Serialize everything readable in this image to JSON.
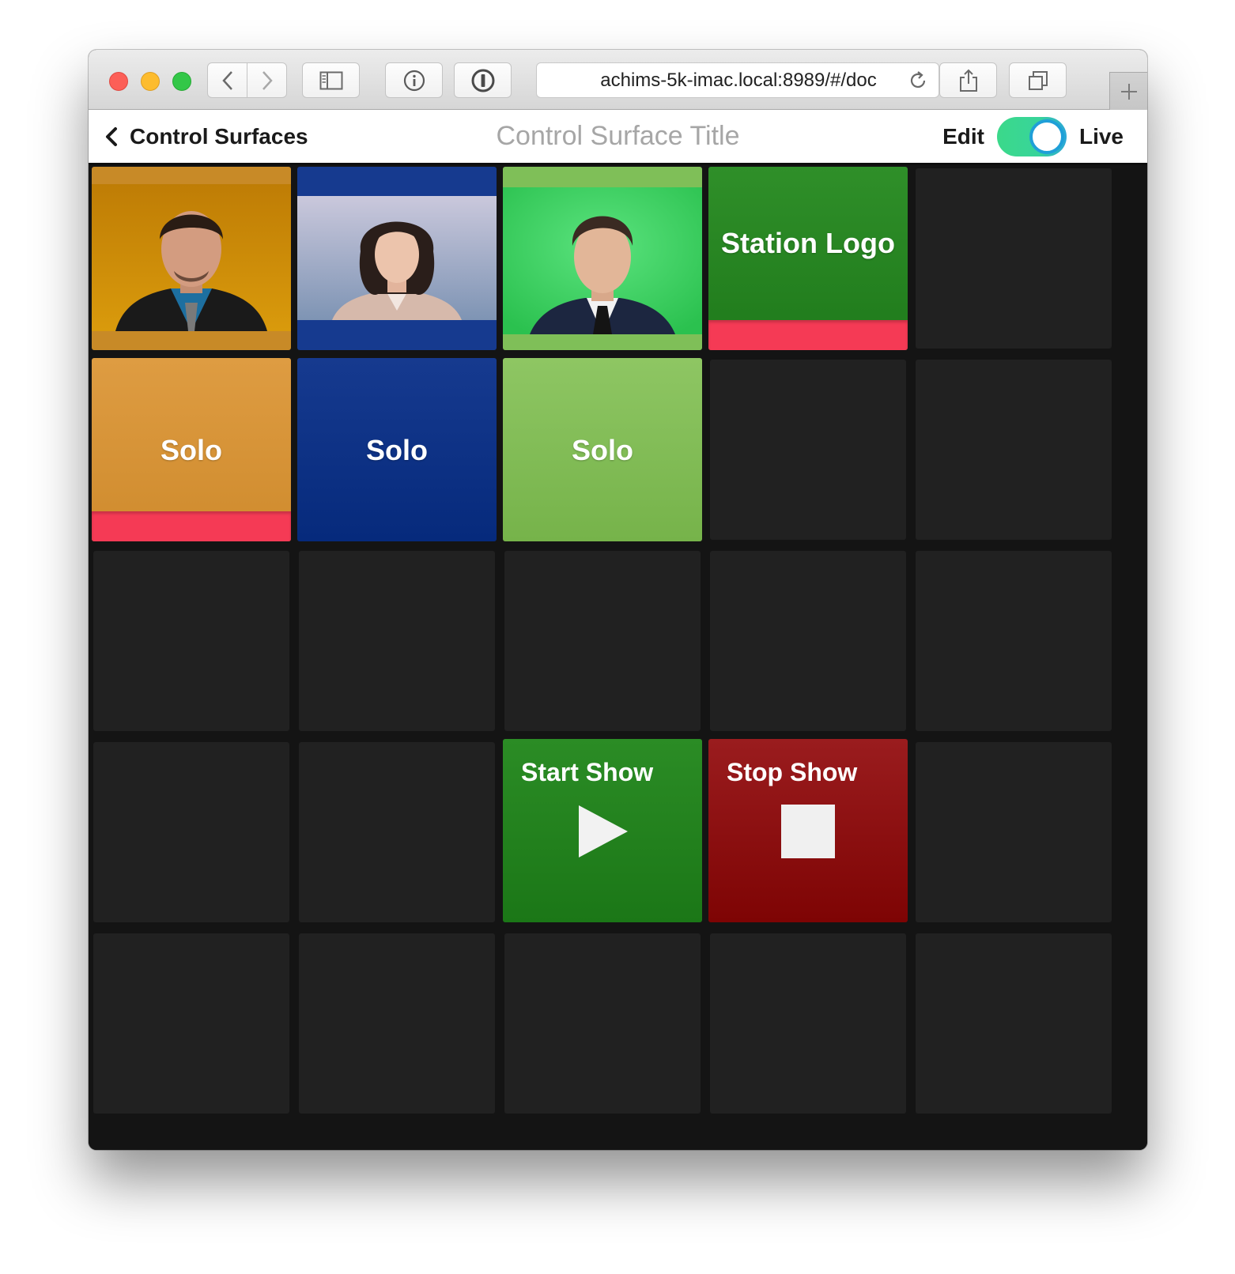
{
  "browser": {
    "url": "achims-5k-imac.local:8989/#/doc",
    "icons": [
      "back-icon",
      "forward-icon",
      "sidebar-icon",
      "info-icon",
      "password-icon",
      "reload-icon",
      "share-icon",
      "tabs-icon",
      "new-tab-icon"
    ]
  },
  "header": {
    "back_label": "Control Surfaces",
    "title": "Control Surface Title",
    "edit_label": "Edit",
    "live_label": "Live",
    "mode": "Live"
  },
  "grid": {
    "rows": 5,
    "columns": 5,
    "tiles": {
      "anchor1": {
        "kind": "photo",
        "color": "#c88a27",
        "on_air": false
      },
      "anchor2": {
        "kind": "photo",
        "color": "#163a8f",
        "on_air": false
      },
      "anchor3": {
        "kind": "photo",
        "color": "#7fbf58",
        "on_air": false
      },
      "station_logo": {
        "label": "Station Logo",
        "color": "#23821f",
        "on_air": true
      },
      "solo1": {
        "label": "Solo",
        "color": "#d9973c",
        "on_air": true
      },
      "solo2": {
        "label": "Solo",
        "color": "#0f3585",
        "on_air": false
      },
      "solo3": {
        "label": "Solo",
        "color": "#86c05c",
        "on_air": false
      },
      "start_show": {
        "label": "Start Show",
        "icon": "play-icon",
        "color": "#22861f"
      },
      "stop_show": {
        "label": "Stop Show",
        "icon": "stop-icon",
        "color": "#8a1214"
      }
    },
    "on_air_color": "#f53a55"
  }
}
